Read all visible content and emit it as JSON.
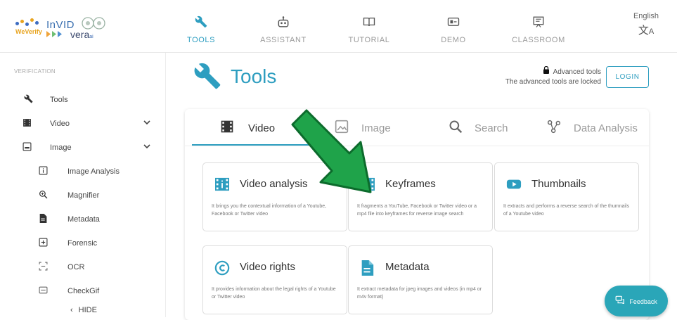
{
  "header": {
    "logo": {
      "weverify": "WeVerify",
      "invid": "InVID",
      "vera": "vera",
      "vera_suffix": "ai"
    },
    "nav": [
      {
        "label": "TOOLS",
        "icon": "wrench-icon",
        "active": true
      },
      {
        "label": "ASSISTANT",
        "icon": "robot-icon",
        "active": false
      },
      {
        "label": "TUTORIAL",
        "icon": "book-icon",
        "active": false
      },
      {
        "label": "DEMO",
        "icon": "demo-icon",
        "active": false
      },
      {
        "label": "CLASSROOM",
        "icon": "classroom-icon",
        "active": false
      }
    ],
    "language": {
      "label": "English",
      "icon": "translate-icon"
    }
  },
  "sidebar": {
    "section": "VERIFICATION",
    "items": [
      {
        "label": "Tools",
        "icon": "wrench-icon"
      },
      {
        "label": "Video",
        "icon": "film-icon",
        "expandable": true
      },
      {
        "label": "Image",
        "icon": "image-icon",
        "expandable": true
      },
      {
        "label": "Image Analysis",
        "icon": "info-box-icon"
      },
      {
        "label": "Magnifier",
        "icon": "zoom-icon"
      },
      {
        "label": "Metadata",
        "icon": "document-icon"
      },
      {
        "label": "Forensic",
        "icon": "forensic-icon"
      },
      {
        "label": "OCR",
        "icon": "ocr-icon"
      },
      {
        "label": "CheckGif",
        "icon": "gif-icon"
      }
    ],
    "hide_label": "HIDE"
  },
  "main": {
    "title": "Tools",
    "advanced": {
      "title": "Advanced tools",
      "subtitle": "The advanced tools are locked",
      "login_label": "LOGIN"
    },
    "tabs": [
      {
        "label": "Video",
        "icon": "film-icon",
        "active": true
      },
      {
        "label": "Image",
        "icon": "image-icon",
        "active": false
      },
      {
        "label": "Search",
        "icon": "search-icon",
        "active": false
      },
      {
        "label": "Data Analysis",
        "icon": "graph-icon",
        "active": false
      }
    ],
    "tools": [
      {
        "title": "Video analysis",
        "icon": "info-box-icon",
        "description": "It brings you the contextual information of a Youtube, Facebook or Twitter video"
      },
      {
        "title": "Keyframes",
        "icon": "film-icon",
        "description": "It fragments a YouTube, Facebook or Twitter video or a mp4 file into keyframes for reverse image search"
      },
      {
        "title": "Thumbnails",
        "icon": "youtube-icon",
        "description": "It extracts and performs a reverse search of the thumnails of a Youtube video"
      },
      {
        "title": "Video rights",
        "icon": "copyright-icon",
        "description": "It provides information about the legal rights of a Youtube or Twitter video"
      },
      {
        "title": "Metadata",
        "icon": "document-icon",
        "description": "It extract metadata for jpeg images and videos (in mp4 or m4v format)"
      }
    ]
  },
  "feedback_label": "Feedback",
  "colors": {
    "accent": "#2e9ec0",
    "arrow": "#1fa34a",
    "feedback": "#2aa6b8"
  }
}
